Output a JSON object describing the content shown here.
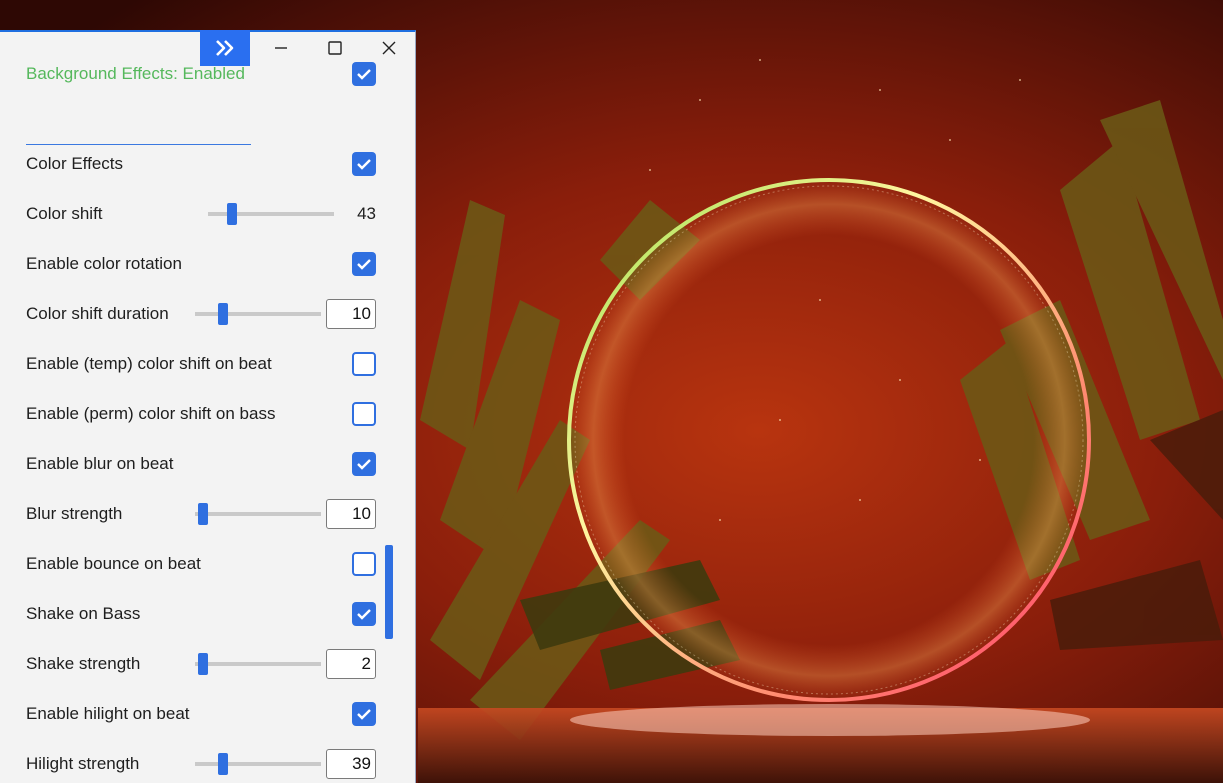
{
  "window": {
    "collapse_icon": "double-chevron-right-icon",
    "minimize_icon": "minimize-icon",
    "maximize_icon": "maximize-icon",
    "close_icon": "close-icon",
    "accent": "#2f6fe0"
  },
  "panel": {
    "header_label": "Background Effects: Enabled",
    "header_checked": true,
    "header_color": "#55b85c",
    "rows": [
      {
        "label": "Color Effects",
        "type": "checkbox",
        "checked": true
      },
      {
        "label": "Color shift",
        "type": "slider-value",
        "value": "43",
        "fraction": 0.15
      },
      {
        "label": "Enable color rotation",
        "type": "checkbox",
        "checked": true
      },
      {
        "label": "Color shift duration",
        "type": "slider-input",
        "value": "10",
        "fraction": 0.18
      },
      {
        "label": "Enable (temp) color shift on beat",
        "type": "checkbox",
        "checked": false
      },
      {
        "label": "Enable (perm) color shift on bass",
        "type": "checkbox",
        "checked": false
      },
      {
        "label": "Enable blur on beat",
        "type": "checkbox",
        "checked": true
      },
      {
        "label": "Blur strength",
        "type": "slider-input",
        "value": "10",
        "fraction": 0.02
      },
      {
        "label": "Enable bounce on beat",
        "type": "checkbox",
        "checked": false
      },
      {
        "label": "Shake on Bass",
        "type": "checkbox",
        "checked": true
      },
      {
        "label": "Shake strength",
        "type": "slider-input",
        "value": "2",
        "fraction": 0.02
      },
      {
        "label": "Enable hilight on beat",
        "type": "checkbox",
        "checked": true
      },
      {
        "label": "Hilight strength",
        "type": "slider-input",
        "value": "39",
        "fraction": 0.18
      }
    ]
  }
}
